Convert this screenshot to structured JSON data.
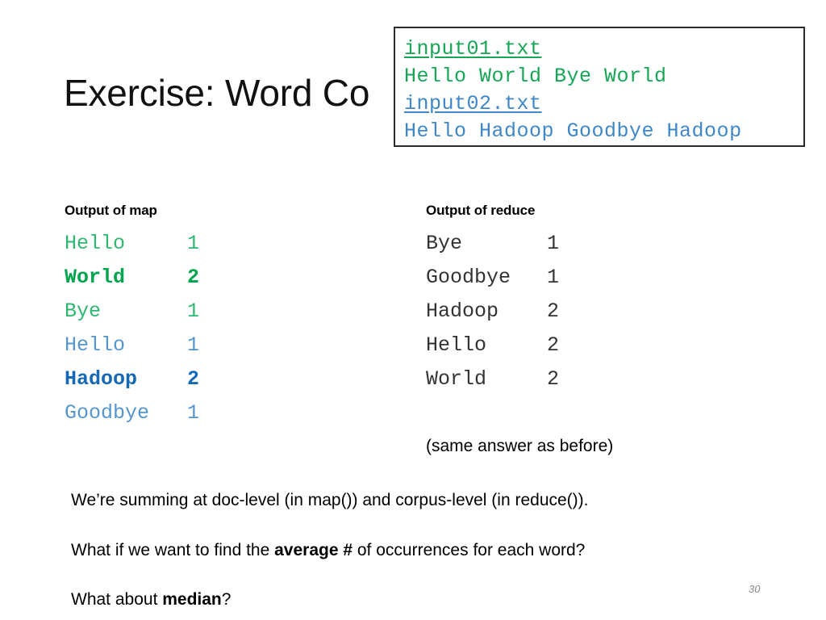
{
  "slide": {
    "title": "Exercise: Word Co",
    "page_number": "30"
  },
  "input_box": {
    "lines": [
      {
        "text": "input01.txt",
        "color": "#16a656",
        "style": "filename"
      },
      {
        "text": "Hello World Bye World",
        "color": "#16a656",
        "style": "content"
      },
      {
        "text": "input02.txt",
        "color": "#3f87c8",
        "style": "filename"
      },
      {
        "text": "Hello Hadoop Goodbye Hadoop",
        "color": "#3f87c8",
        "style": "content"
      }
    ]
  },
  "map_column": {
    "header": "Output of map",
    "rows": [
      {
        "word": "Hello",
        "count": "1",
        "color": "#2eb872",
        "bold": false
      },
      {
        "word": "World",
        "count": "2",
        "color": "#00a550",
        "bold": true
      },
      {
        "word": "Bye",
        "count": "1",
        "color": "#2eb872",
        "bold": false
      },
      {
        "word": "Hello",
        "count": "1",
        "color": "#5596cf",
        "bold": false
      },
      {
        "word": "Hadoop",
        "count": "2",
        "color": "#1569b5",
        "bold": true
      },
      {
        "word": "Goodbye",
        "count": "1",
        "color": "#5596cf",
        "bold": false
      }
    ]
  },
  "reduce_column": {
    "header": "Output of reduce",
    "rows": [
      {
        "word": "Bye",
        "count": "1",
        "color": "#333333",
        "bold": false
      },
      {
        "word": "Goodbye",
        "count": "1",
        "color": "#333333",
        "bold": false
      },
      {
        "word": "Hadoop",
        "count": "2",
        "color": "#333333",
        "bold": false
      },
      {
        "word": "Hello",
        "count": "2",
        "color": "#333333",
        "bold": false
      },
      {
        "word": "World",
        "count": "2",
        "color": "#333333",
        "bold": false
      }
    ],
    "note": "(same answer as before)"
  },
  "prose": {
    "line1": "We’re summing at doc-level (in map()) and corpus-level (in reduce()).",
    "line2_pre": "What if we want to find the ",
    "line2_bold": "average #",
    "line2_post": " of occurrences for each word?",
    "line3_pre": "What about ",
    "line3_bold": "median",
    "line3_post": "?"
  },
  "colors": {
    "green_light": "#2eb872",
    "green_bold": "#00a550",
    "blue_light": "#5596cf",
    "blue_bold": "#1569b5",
    "box_border": "#2b2b2b",
    "page_number": "#8a8a8a"
  }
}
